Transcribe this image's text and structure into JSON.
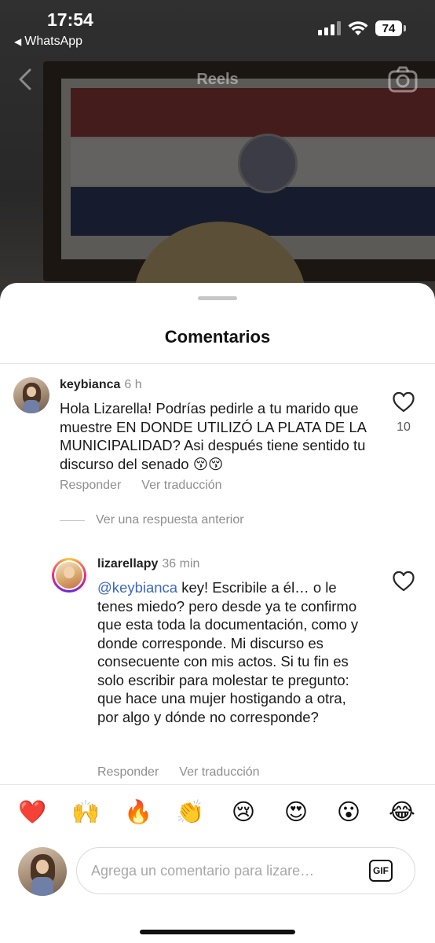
{
  "status_bar": {
    "time": "17:54",
    "back_app": "WhatsApp",
    "battery": "74"
  },
  "reel_header": {
    "title": "Reels"
  },
  "sheet": {
    "title": "Comentarios"
  },
  "comments": [
    {
      "username": "keybianca",
      "time": "6 h",
      "text": "Hola Lizarella! Podrías pedirle a tu marido que muestre EN DONDE UTILIZÓ LA PLATA DE LA MUNICIPALIDAD? Asi después tiene sentido tu discurso del senado 😚😚",
      "likes": "10",
      "reply_label": "Responder",
      "translate_label": "Ver traducción"
    }
  ],
  "view_replies_label": "Ver una respuesta anterior",
  "reply": {
    "username": "lizarellapy",
    "time": "36 min",
    "mention": "@keybianca",
    "text": " key! Escribile a él… o le tenes miedo? pero desde ya te confirmo que esta toda la documentación, como y donde corresponde.  Mi discurso es consecuente con mis actos. Si tu fin es solo escribir para molestar te pregunto: que hace una mujer hostigando a otra, por algo y dónde no corresponde?",
    "reply_label": "Responder",
    "translate_label": "Ver traducción"
  },
  "emoji_bar": [
    "❤️",
    "🙌",
    "🔥",
    "👏",
    "😢",
    "😍",
    "😮",
    "😂"
  ],
  "composer": {
    "placeholder": "Agrega un comentario para lizare…",
    "gif_label": "GIF"
  },
  "colors": {
    "mention": "#3d67c4",
    "secondary_text": "#8e8e8e",
    "like_outline": "#262626"
  },
  "icons": [
    "back-chevron-icon",
    "camera-icon",
    "heart-outline-icon",
    "signal-icon",
    "wifi-icon",
    "gif-icon"
  ]
}
